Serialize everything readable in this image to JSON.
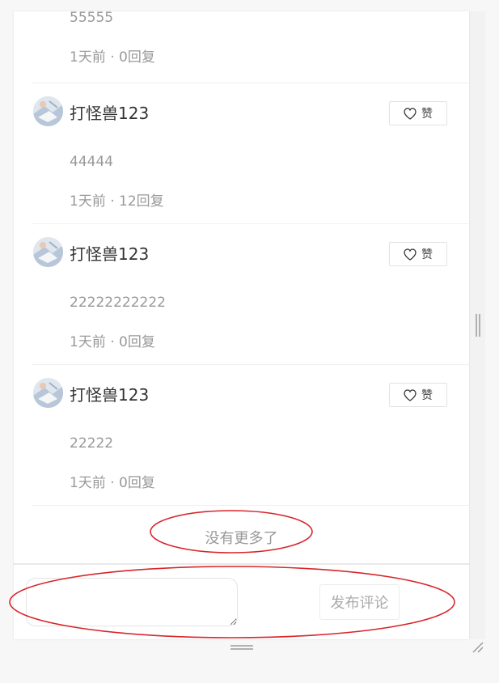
{
  "comments": [
    {
      "author": "",
      "content": "55555",
      "meta": "1天前 · 0回复",
      "like_label": ""
    },
    {
      "author": "打怪兽123",
      "content": "44444",
      "meta": "1天前 · 12回复",
      "like_label": "赞"
    },
    {
      "author": "打怪兽123",
      "content": "22222222222",
      "meta": "1天前 · 0回复",
      "like_label": "赞"
    },
    {
      "author": "打怪兽123",
      "content": "22222",
      "meta": "1天前 · 0回复",
      "like_label": "赞"
    }
  ],
  "list_end_text": "没有更多了",
  "composer": {
    "input_value": "",
    "input_placeholder": "",
    "publish_label": "发布评论"
  },
  "colors": {
    "annotation_red": "#d9252a",
    "text_primary": "#333333",
    "text_secondary": "#999999"
  },
  "icons": {
    "like": "heart-outline-icon",
    "avatar": "avatar-image"
  }
}
